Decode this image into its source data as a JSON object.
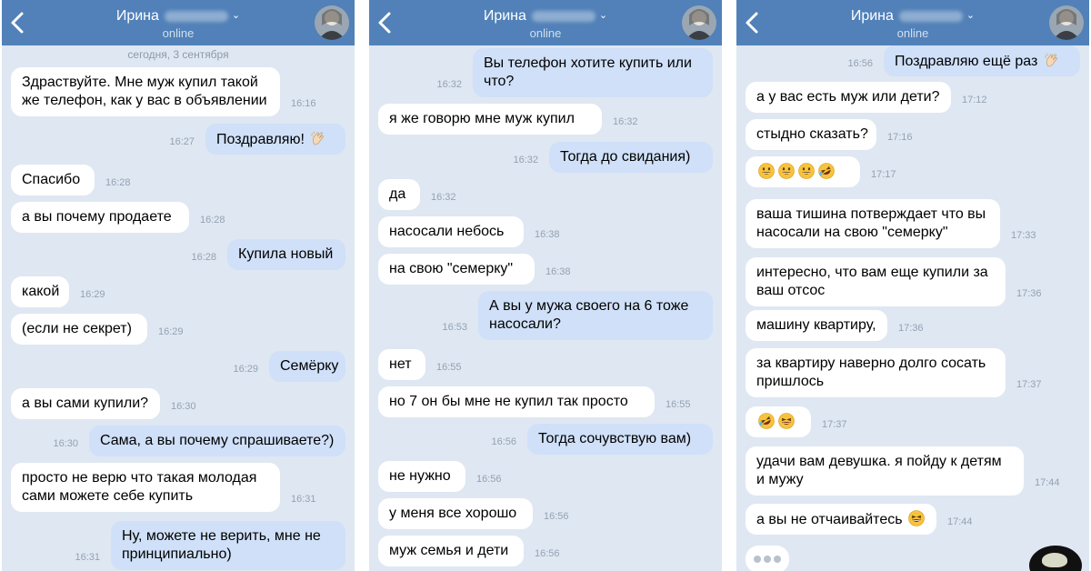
{
  "panels": [
    {
      "contact_name": "Ирина",
      "status": "online",
      "date_label": "сегодня, 3 сентября",
      "messages": [
        {
          "dir": "in",
          "lines": [
            "Здраствуйте. Мне муж купил такой",
            "же телефон, как у вас в объявлении"
          ],
          "time": "16:16"
        },
        {
          "dir": "out",
          "lines": [
            "Поздравляю! [clap]"
          ],
          "time": "16:27"
        },
        {
          "dir": "in",
          "lines": [
            "Спасибо"
          ],
          "time": "16:28"
        },
        {
          "dir": "in",
          "lines": [
            "а вы почему продаете"
          ],
          "time": "16:28"
        },
        {
          "dir": "out",
          "lines": [
            "Купила новый"
          ],
          "time": "16:28"
        },
        {
          "dir": "in",
          "lines": [
            "какой"
          ],
          "time": "16:29"
        },
        {
          "dir": "in",
          "lines": [
            "(если не секрет)"
          ],
          "time": "16:29"
        },
        {
          "dir": "out",
          "lines": [
            "Семёрку"
          ],
          "time": "16:29"
        },
        {
          "dir": "in",
          "lines": [
            "а вы сами купили?"
          ],
          "time": "16:30"
        },
        {
          "dir": "out",
          "lines": [
            "Сама, а вы почему спрашиваете?)"
          ],
          "time": "16:30"
        },
        {
          "dir": "in",
          "lines": [
            "просто не верю что такая молодая",
            "сами можете себе купить"
          ],
          "time": "16:31"
        },
        {
          "dir": "out",
          "lines": [
            "Ну, можете не верить, мне не",
            "принципиально)"
          ],
          "time": "16:31"
        }
      ]
    },
    {
      "contact_name": "Ирина",
      "status": "online",
      "messages": [
        {
          "dir": "out",
          "lines": [
            "Вы телефон хотите купить или",
            "что?"
          ],
          "time": "16:32"
        },
        {
          "dir": "in",
          "lines": [
            "я же говорю мне муж купил"
          ],
          "time": "16:32"
        },
        {
          "dir": "out",
          "lines": [
            "Тогда до свидания)"
          ],
          "time": "16:32"
        },
        {
          "dir": "in",
          "lines": [
            "да"
          ],
          "time": "16:32"
        },
        {
          "dir": "in",
          "lines": [
            "насосали небось"
          ],
          "time": "16:38"
        },
        {
          "dir": "in",
          "lines": [
            "на свою \"семерку\""
          ],
          "time": "16:38"
        },
        {
          "dir": "out",
          "lines": [
            "А вы у мужа своего на 6 тоже",
            "насосали?"
          ],
          "time": "16:53"
        },
        {
          "dir": "in",
          "lines": [
            "нет"
          ],
          "time": "16:55"
        },
        {
          "dir": "in",
          "lines": [
            "но 7 он бы мне не купил так просто"
          ],
          "time": "16:55"
        },
        {
          "dir": "out",
          "lines": [
            "Тогда сочувствую вам)"
          ],
          "time": "16:56"
        },
        {
          "dir": "in",
          "lines": [
            "не нужно"
          ],
          "time": "16:56"
        },
        {
          "dir": "in",
          "lines": [
            "у меня все хорошо"
          ],
          "time": "16:56"
        },
        {
          "dir": "in",
          "lines": [
            "муж семья и дети"
          ],
          "time": "16:56"
        }
      ]
    },
    {
      "contact_name": "Ирина",
      "status": "online",
      "messages": [
        {
          "dir": "out",
          "lines": [
            "Поздравляю ещё раз [clap]"
          ],
          "time": "16:56"
        },
        {
          "dir": "in",
          "lines": [
            "а у вас есть муж или дети?"
          ],
          "time": "17:12"
        },
        {
          "dir": "in",
          "lines": [
            "стыдно сказать?"
          ],
          "time": "17:16"
        },
        {
          "dir": "in",
          "lines": [
            "[grin][grin][grin][rofl]"
          ],
          "time": "17:17"
        },
        {
          "dir": "in",
          "lines": [
            "ваша тишина потверждает что вы",
            "насосали на свою \"семерку\""
          ],
          "time": "17:33"
        },
        {
          "dir": "in",
          "lines": [
            "интересно, что вам еще купили за",
            "ваш отсос"
          ],
          "time": "17:36"
        },
        {
          "dir": "in",
          "lines": [
            "машину квартиру,"
          ],
          "time": "17:36"
        },
        {
          "dir": "in",
          "lines": [
            "за квартиру наверно долго сосать",
            "пришлось"
          ],
          "time": "17:37"
        },
        {
          "dir": "in",
          "lines": [
            "[rofl][laugh]"
          ],
          "time": "17:37"
        },
        {
          "dir": "in",
          "lines": [
            "удачи вам девушка. я пойду к детям",
            "и мужу"
          ],
          "time": "17:44"
        },
        {
          "dir": "in",
          "lines": [
            "а вы не отчаивайтесь [laugh]"
          ],
          "time": "17:44"
        }
      ],
      "typing": true
    }
  ],
  "colors": {
    "header": "#5181b8",
    "background": "#dfe7f2",
    "incoming_bubble": "#ffffff",
    "outgoing_bubble": "#cfe0f8",
    "time_text": "#93a2b3"
  },
  "icons": {
    "back": "chevron-left-icon",
    "dropdown": "chevron-down-icon",
    "clap": "clapping-hands-emoji",
    "grin": "grinning-face-emoji",
    "rofl": "rolling-on-floor-laughing-emoji",
    "laugh": "laughing-face-emoji"
  }
}
